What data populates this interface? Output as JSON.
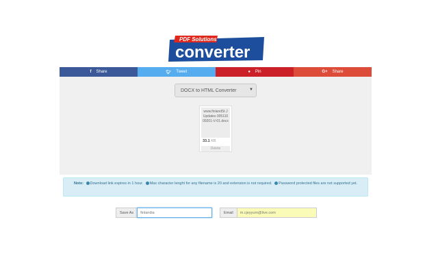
{
  "logo": {
    "tag": "PDF Solutions",
    "text": "converter"
  },
  "social": [
    {
      "icon": "f",
      "label": "Share"
    },
    {
      "icon": "t",
      "label": "Tweet"
    },
    {
      "icon": "p",
      "label": "Pin"
    },
    {
      "icon": "G+",
      "label": "Share"
    }
  ],
  "converter": {
    "selected": "DOCX to HTML Converter"
  },
  "file": {
    "name": "www.finlandSt JUpdates 00511009201-V-01.docx",
    "size_value": "33.1",
    "size_unit": "KB",
    "delete_label": "Delete"
  },
  "notice": {
    "title": "Note:",
    "items": [
      "Download link expires in 1 hour.",
      "Max character lenght for any filename is 20 and extension is not required.",
      "Password protected files are not supported yet."
    ]
  },
  "save_as": {
    "label": "Save As",
    "value": "finlandia"
  },
  "email": {
    "label": "Email",
    "value": "m.cjeyyum@live.com"
  }
}
